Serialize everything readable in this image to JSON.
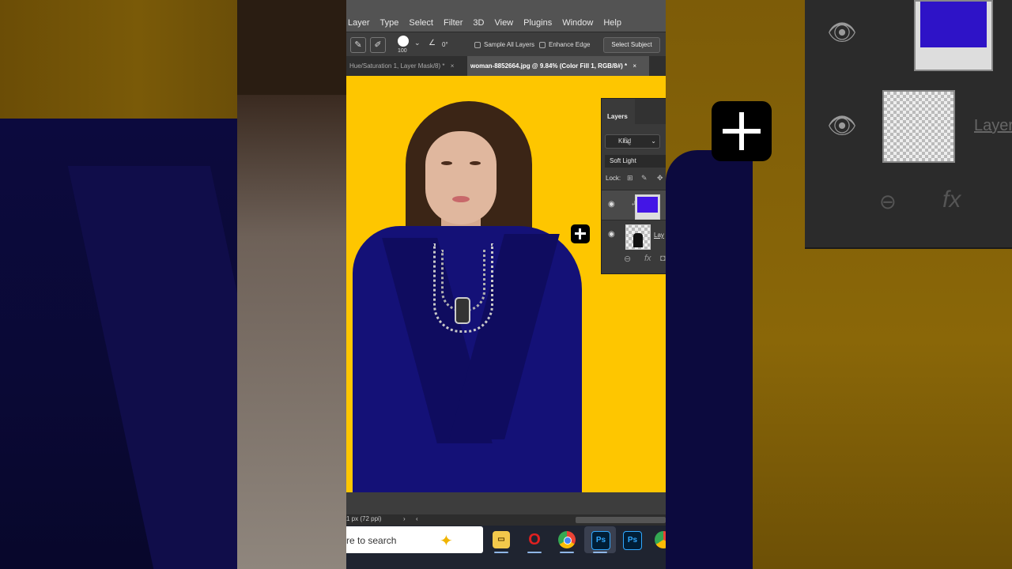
{
  "menu": [
    "Layer",
    "Type",
    "Select",
    "Filter",
    "3D",
    "View",
    "Plugins",
    "Window",
    "Help"
  ],
  "options": {
    "brush_size": "100",
    "angle": "0°",
    "sample_all_layers": "Sample All Layers",
    "enhance_edge": "Enhance Edge",
    "select_subject": "Select Subject"
  },
  "tabs": {
    "inactive": "Hue/Saturation 1, Layer Mask/8) *",
    "active": "woman-8852664.jpg @ 9.84% (Color Fill 1, RGB/8#) *",
    "close": "×"
  },
  "layers_panel": {
    "title": "Layers",
    "filter": "Kind",
    "blend_mode": "Soft Light",
    "lock_label": "Lock:",
    "layer2_name": "Lay",
    "footer_fx": "fx"
  },
  "status": {
    "resolution": "1 px (72 ppi)",
    "nav_next": "›",
    "nav_prev": "‹"
  },
  "taskbar": {
    "search_text": "re to search",
    "ps_label": "Ps"
  },
  "right_overlay": {
    "layer_label": "Layer",
    "fx": "fx"
  },
  "colors": {
    "canvas_bg": "#fec600",
    "jacket": "#141177",
    "fill_swatch": "#4315e6"
  }
}
